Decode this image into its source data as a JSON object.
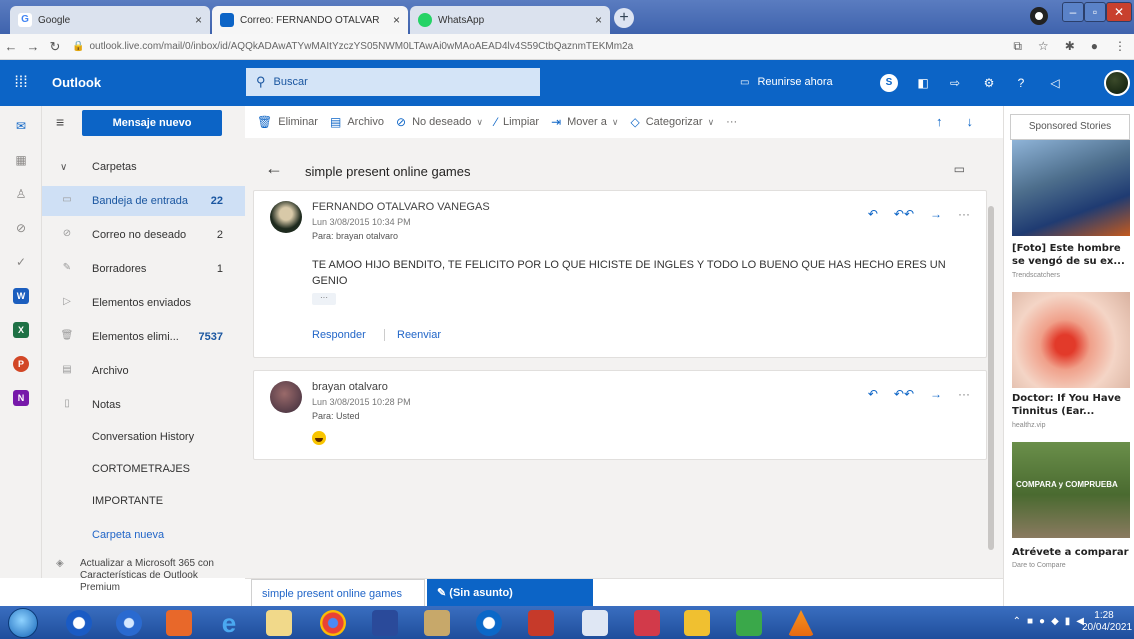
{
  "browser": {
    "tabs": [
      {
        "label": "Google"
      },
      {
        "label": "Correo: FERNANDO OTALVARO"
      },
      {
        "label": "WhatsApp"
      }
    ],
    "url": "outlook.live.com/mail/0/inbox/id/AQQkADAwATYwMAItYzczYS05NWM0LTAwAi0wMAoAEAD4lv4S59CtbQaznmTEKMm2a"
  },
  "topbar": {
    "app_name": "Outlook",
    "search_placeholder": "Buscar",
    "meet_label": "Reunirse ahora"
  },
  "folders": {
    "new_message": "Mensaje nuevo",
    "header": "Carpetas",
    "items": [
      {
        "label": "Bandeja de entrada",
        "count": "22"
      },
      {
        "label": "Correo no deseado",
        "count": "2"
      },
      {
        "label": "Borradores",
        "count": "1"
      },
      {
        "label": "Elementos enviados",
        "count": ""
      },
      {
        "label": "Elementos elimi...",
        "count": "7537"
      },
      {
        "label": "Archivo",
        "count": ""
      },
      {
        "label": "Notas",
        "count": ""
      },
      {
        "label": "Conversation History",
        "count": ""
      },
      {
        "label": "CORTOMETRAJES",
        "count": ""
      },
      {
        "label": "IMPORTANTE",
        "count": ""
      },
      {
        "label": "Carpeta nueva",
        "count": ""
      }
    ],
    "upgrade_text": "Actualizar a Microsoft 365 con Características de Outlook Premium"
  },
  "toolbar": {
    "delete": "Eliminar",
    "archive": "Archivo",
    "junk": "No deseado",
    "sweep": "Limpiar",
    "move": "Mover a",
    "categorize": "Categorizar",
    "more": "···"
  },
  "conversation": {
    "subject": "simple present online games",
    "messages": [
      {
        "sender": "FERNANDO OTALVARO VANEGAS",
        "date": "Lun 3/08/2015 10:34 PM",
        "to": "Para: brayan otalvaro",
        "body": "TE AMOO HIJO BENDITO, TE FELICITO POR LO QUE HICISTE DE INGLES Y TODO LO BUENO QUE HAS HECHO ERES UN GENIO",
        "ellipsis": "···",
        "reply": "Responder",
        "forward": "Reenviar"
      },
      {
        "sender": "brayan otalvaro",
        "date": "Lun 3/08/2015 10:28 PM",
        "to": "Para: Usted"
      }
    ]
  },
  "drafts": {
    "tab1": "simple present online games",
    "tab2": "(Sin asunto)"
  },
  "ads": {
    "header": "Sponsored Stories",
    "items": [
      {
        "title": "[Foto] Este hombre se vengó de su ex...",
        "source": "Trendscatchers"
      },
      {
        "title": "Doctor: If You Have Tinnitus (Ear...",
        "source": "healthz.vip"
      },
      {
        "title": "Atrévete a comparar",
        "source": "Dare to Compare",
        "banner": "COMPARA y COMPRUEBA"
      }
    ]
  },
  "clock": {
    "time": "1:28",
    "date": "20/04/2021"
  },
  "colors": {
    "outlook_blue": "#0c64c6",
    "selected_folder": "#cfe0f5"
  }
}
